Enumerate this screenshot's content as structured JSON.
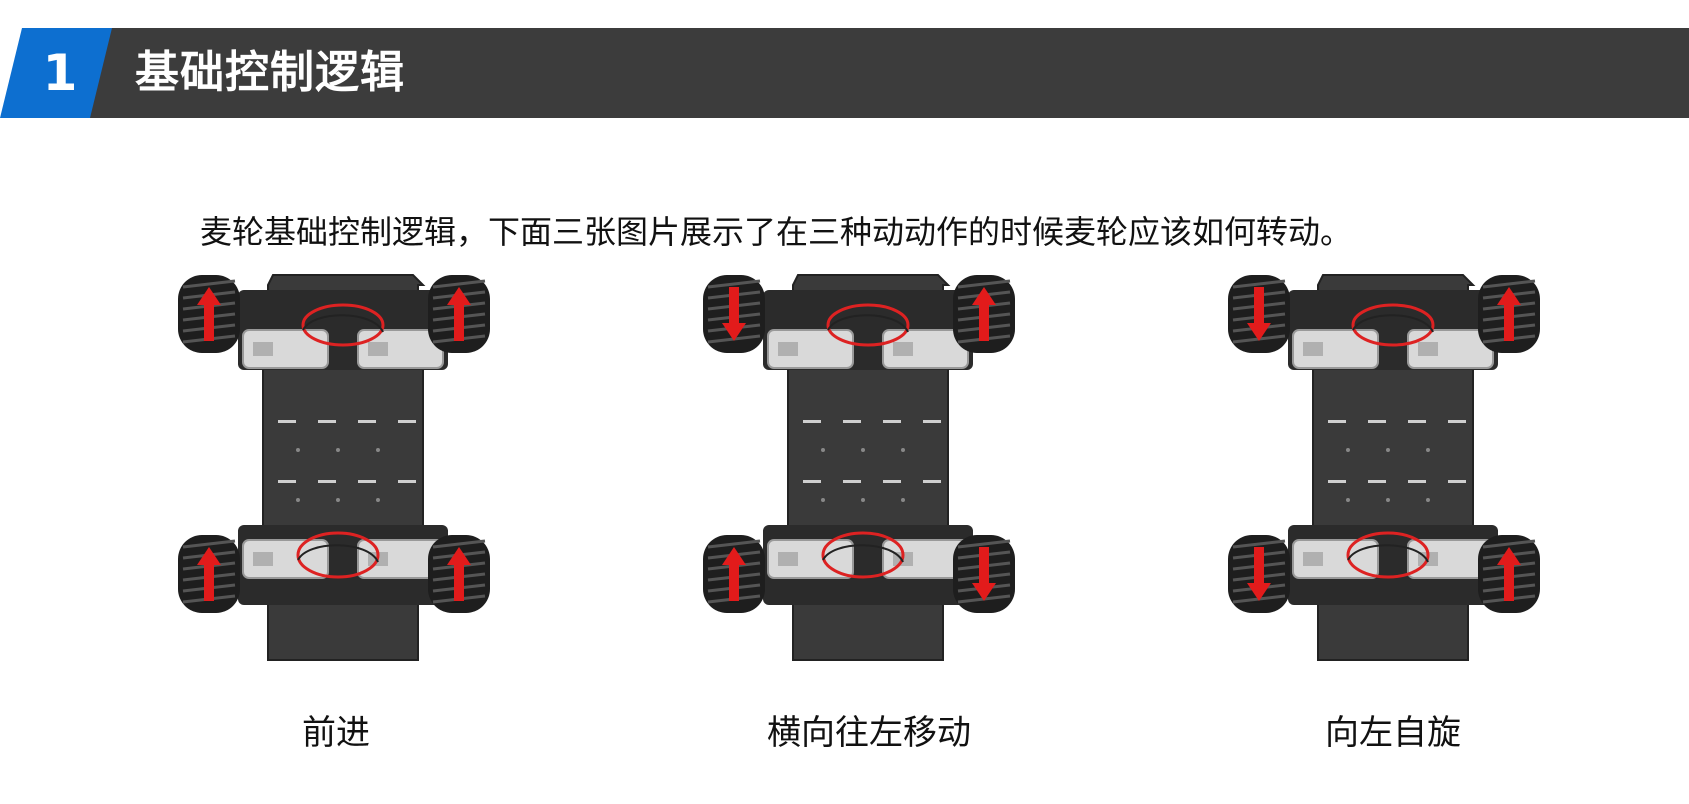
{
  "header": {
    "number": "1",
    "title": "基础控制逻辑",
    "bar_color": "#3c3c3c",
    "accent_color": "#0d6fd0"
  },
  "description": "麦轮基础控制逻辑，下面三张图片展示了在三种动动作的时候麦轮应该如何转动。",
  "panels": [
    {
      "caption": "前进",
      "wheel_arrows": {
        "front_left": "up",
        "front_right": "up",
        "rear_left": "up",
        "rear_right": "up"
      }
    },
    {
      "caption": "横向往左移动",
      "wheel_arrows": {
        "front_left": "down",
        "front_right": "up",
        "rear_left": "up",
        "rear_right": "down"
      }
    },
    {
      "caption": "向左自旋",
      "wheel_arrows": {
        "front_left": "down",
        "front_right": "up",
        "rear_left": "down",
        "rear_right": "up"
      }
    }
  ],
  "arrow_color": "#e21b1b"
}
